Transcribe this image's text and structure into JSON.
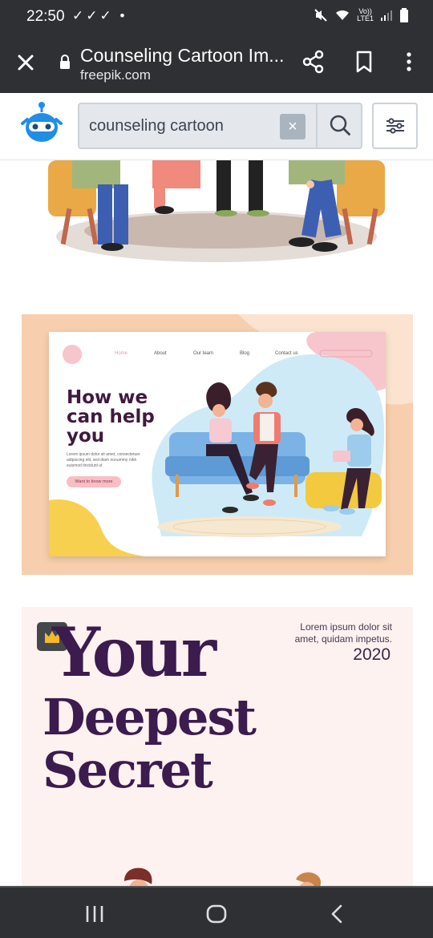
{
  "status_bar": {
    "time": "22:50",
    "checks": "✓✓✓",
    "dot": "•",
    "network_top": "Vo))",
    "network_bottom": "LTE1"
  },
  "browser": {
    "title": "Counseling Cartoon Im...",
    "domain": "freepik.com"
  },
  "search": {
    "query": "counseling cartoon",
    "clear_glyph": "×"
  },
  "landing_card": {
    "nav": [
      "Home",
      "About",
      "Our team",
      "Blog",
      "Contact us"
    ],
    "headline": "How we can help you",
    "body": "Lorem ipsum dolor sit amet, consectetuer adipiscing elit, sed diam nonummy nibh euismod tincidunt ut",
    "cta": "Want to know more"
  },
  "book_card": {
    "line1": "Your",
    "line2": "Deepest",
    "line3": "Secret",
    "lorem": "Lorem ipsum dolor sit amet, quidam impetus.",
    "year": "2020"
  },
  "colors": {
    "browser_bar": "#2f3034",
    "logo_blue": "#1f8ee6",
    "book_purple": "#3c1b4f",
    "landing_peach": "#f7cfae"
  }
}
